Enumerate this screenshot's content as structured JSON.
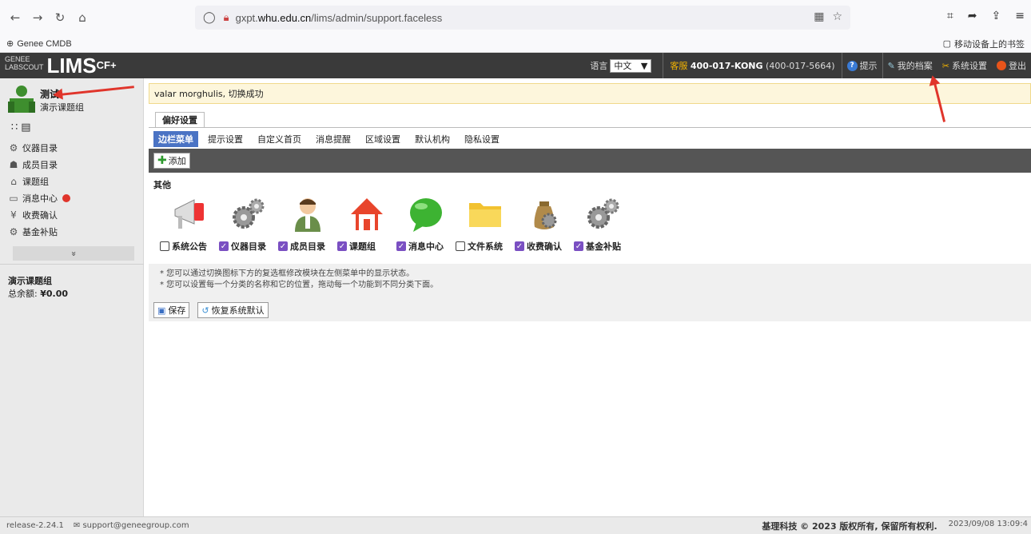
{
  "browser": {
    "url_prefix": "gxpt.",
    "url_domain": "whu.edu.cn",
    "url_path": "/lims/admin/support.faceless",
    "bookmark_left": "Genee CMDB",
    "bookmark_right": "移动设备上的书签"
  },
  "header": {
    "logo_small_1": "GENEE",
    "logo_small_2": "LABSCOUT",
    "logo_main": "LIMS",
    "logo_sup": "CF+",
    "lang_label": "语言",
    "lang_value": "中文",
    "hotline_label": "客服",
    "hotline_number": "400-017-KONG",
    "hotline_alt": "(400-017-5664)",
    "help": "提示",
    "profile": "我的档案",
    "settings": "系统设置",
    "logout": "登出"
  },
  "sidebar": {
    "group_title": "测试",
    "group_sub": "演示课题组",
    "items": [
      {
        "label": "仪器目录",
        "icon": "gear-icon",
        "glyph": "⚙"
      },
      {
        "label": "成员目录",
        "icon": "person-icon",
        "glyph": "☗"
      },
      {
        "label": "课题组",
        "icon": "home-icon",
        "glyph": "⌂"
      },
      {
        "label": "消息中心",
        "icon": "message-icon",
        "glyph": "▭"
      },
      {
        "label": "收费确认",
        "icon": "yen-icon",
        "glyph": "¥"
      },
      {
        "label": "基金补贴",
        "icon": "gear-icon",
        "glyph": "⚙"
      }
    ],
    "expand_glyph": "»",
    "balance_title": "演示课题组",
    "balance_label": "总余额:",
    "balance_value": "¥0.00"
  },
  "main": {
    "notice": "valar morghulis, 切换成功",
    "tab": "偏好设置",
    "subtabs": [
      "边栏菜单",
      "提示设置",
      "自定义首页",
      "消息提醒",
      "区域设置",
      "默认机构",
      "隐私设置"
    ],
    "add": "添加",
    "section": "其他",
    "modules": [
      {
        "label": "系统公告",
        "checked": false,
        "icon": "megaphone-icon"
      },
      {
        "label": "仪器目录",
        "checked": true,
        "icon": "gears-icon"
      },
      {
        "label": "成员目录",
        "checked": true,
        "icon": "person-icon"
      },
      {
        "label": "课题组",
        "checked": true,
        "icon": "house-icon"
      },
      {
        "label": "消息中心",
        "checked": true,
        "icon": "chat-bubble-icon"
      },
      {
        "label": "文件系统",
        "checked": false,
        "icon": "folder-icon"
      },
      {
        "label": "收费确认",
        "checked": true,
        "icon": "money-bag-icon"
      },
      {
        "label": "基金补贴",
        "checked": true,
        "icon": "gears-icon"
      }
    ],
    "hint1": "* 您可以通过切换图标下方的复选框修改模块在左侧菜单中的显示状态。",
    "hint2": "* 您可以设置每一个分类的名称和它的位置，拖动每一个功能到不同分类下面。",
    "save": "保存",
    "restore": "恢复系统默认"
  },
  "status": {
    "version": "release-2.24.1",
    "email": "support@geneegroup.com",
    "copyright": "基理科技 © 2023 版权所有, 保留所有权利.",
    "datetime": "2023/09/08 13:09:4"
  },
  "colors": {
    "header_bg": "#3a3a3a",
    "active_tab": "#4a73c4",
    "checkbox": "#7a4fc2",
    "arrow": "#e0352b"
  }
}
